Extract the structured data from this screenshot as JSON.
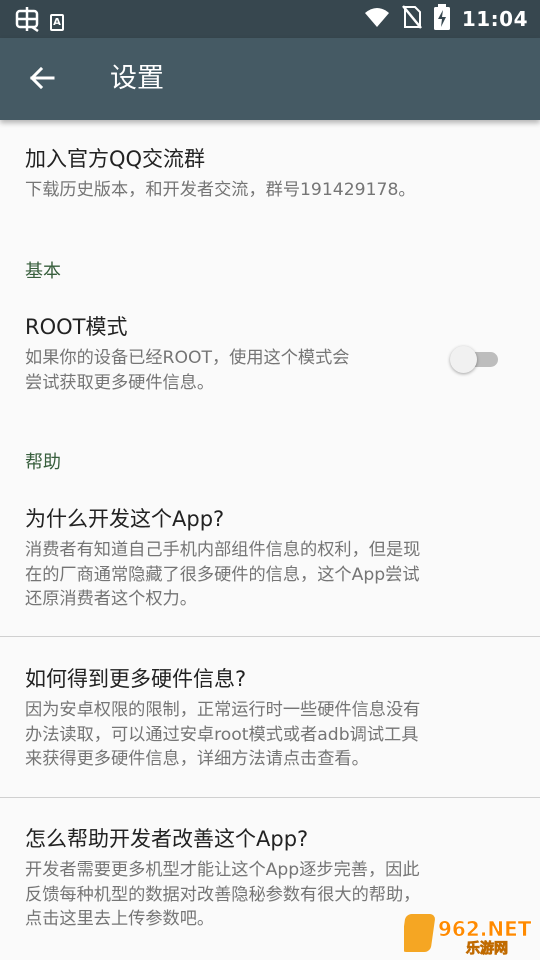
{
  "status_bar": {
    "time": "11:04",
    "left_icons": [
      "bug-icon",
      "a-notification-icon"
    ],
    "right_icons": [
      "wifi-icon",
      "no-sim-icon",
      "battery-charging-icon"
    ]
  },
  "app_bar": {
    "title": "设置",
    "back_icon": "arrow-left-icon"
  },
  "items": {
    "qq_group": {
      "title": "加入官方QQ交流群",
      "summary": "下载历史版本，和开发者交流，群号191429178。"
    },
    "basic_category": "基本",
    "root_mode": {
      "title": "ROOT模式",
      "summary_line1": "如果你的设备已经ROOT，使用这个模式会",
      "summary_line2": "尝试获取更多硬件信息。",
      "enabled": false
    },
    "help_category": "帮助",
    "why_develop": {
      "title": "为什么开发这个App?",
      "summary_line1": "消费者有知道自己手机内部组件信息的权利，但是现",
      "summary_line2": "在的厂商通常隐藏了很多硬件的信息，这个App尝试",
      "summary_line3": "还原消费者这个权力。"
    },
    "more_info": {
      "title": "如何得到更多硬件信息?",
      "summary_line1": "因为安卓权限的限制，正常运行时一些硬件信息没有",
      "summary_line2": "办法读取，可以通过安卓root模式或者adb调试工具",
      "summary_line3": "来获得更多硬件信息，详细方法请点击查看。"
    },
    "help_improve": {
      "title": "怎么帮助开发者改善这个App?",
      "summary_line1": "开发者需要更多机型才能让这个App逐步完善，因此",
      "summary_line2": "反馈每种机型的数据对改善隐秘参数有很大的帮助，",
      "summary_line3": "点击这里去上传参数吧。"
    }
  },
  "watermark": {
    "text_top": "962.NET",
    "text_bottom": "乐游网"
  },
  "colors": {
    "status_bar": "#37474f",
    "app_bar": "#455a64",
    "category": "#375e3c",
    "background": "#fafafa"
  }
}
